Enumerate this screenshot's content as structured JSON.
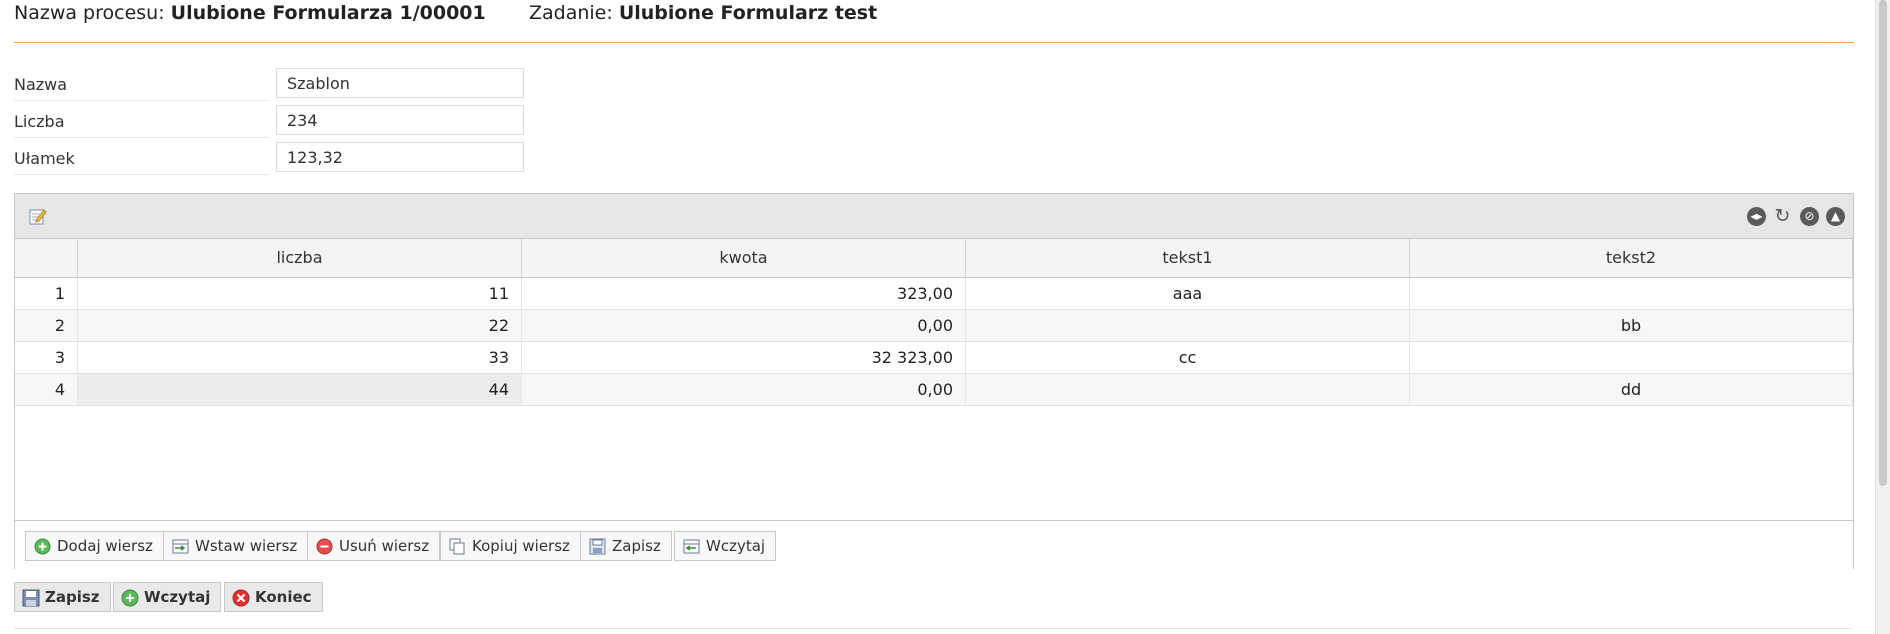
{
  "header": {
    "process_label": "Nazwa procesu:",
    "process_value": "Ulubione Formularza 1/00001",
    "task_label": "Zadanie:",
    "task_value": "Ulubione Formularz test"
  },
  "form": {
    "fields": [
      {
        "label": "Nazwa",
        "value": "Szablon"
      },
      {
        "label": "Liczba",
        "value": "234"
      },
      {
        "label": "Ułamek",
        "value": "123,32"
      }
    ]
  },
  "grid": {
    "toolbar_icons": [
      "edit-icon",
      "collapse-columns-icon",
      "refresh-icon",
      "cancel-icon",
      "collapse-up-icon"
    ],
    "columns": [
      "liczba",
      "kwota",
      "tekst1",
      "tekst2"
    ],
    "rows": [
      {
        "n": "1",
        "liczba": "11",
        "kwota": "323,00",
        "tekst1": "aaa",
        "tekst2": ""
      },
      {
        "n": "2",
        "liczba": "22",
        "kwota": "0,00",
        "tekst1": "",
        "tekst2": "bb"
      },
      {
        "n": "3",
        "liczba": "33",
        "kwota": "32 323,00",
        "tekst1": "cc",
        "tekst2": ""
      },
      {
        "n": "4",
        "liczba": "44",
        "kwota": "0,00",
        "tekst1": "",
        "tekst2": "dd"
      }
    ],
    "buttons": {
      "add": "Dodaj wiersz",
      "insert": "Wstaw wiersz",
      "delete": "Usuń wiersz",
      "copy": "Kopiuj wiersz",
      "save": "Zapisz",
      "load": "Wczytaj"
    }
  },
  "actions": {
    "save": "Zapisz",
    "load": "Wczytaj",
    "end": "Koniec"
  },
  "colors": {
    "accent_line": "#f0a050",
    "add_green": "#5cb85c",
    "delete_red": "#e05050",
    "end_red": "#e53030"
  }
}
